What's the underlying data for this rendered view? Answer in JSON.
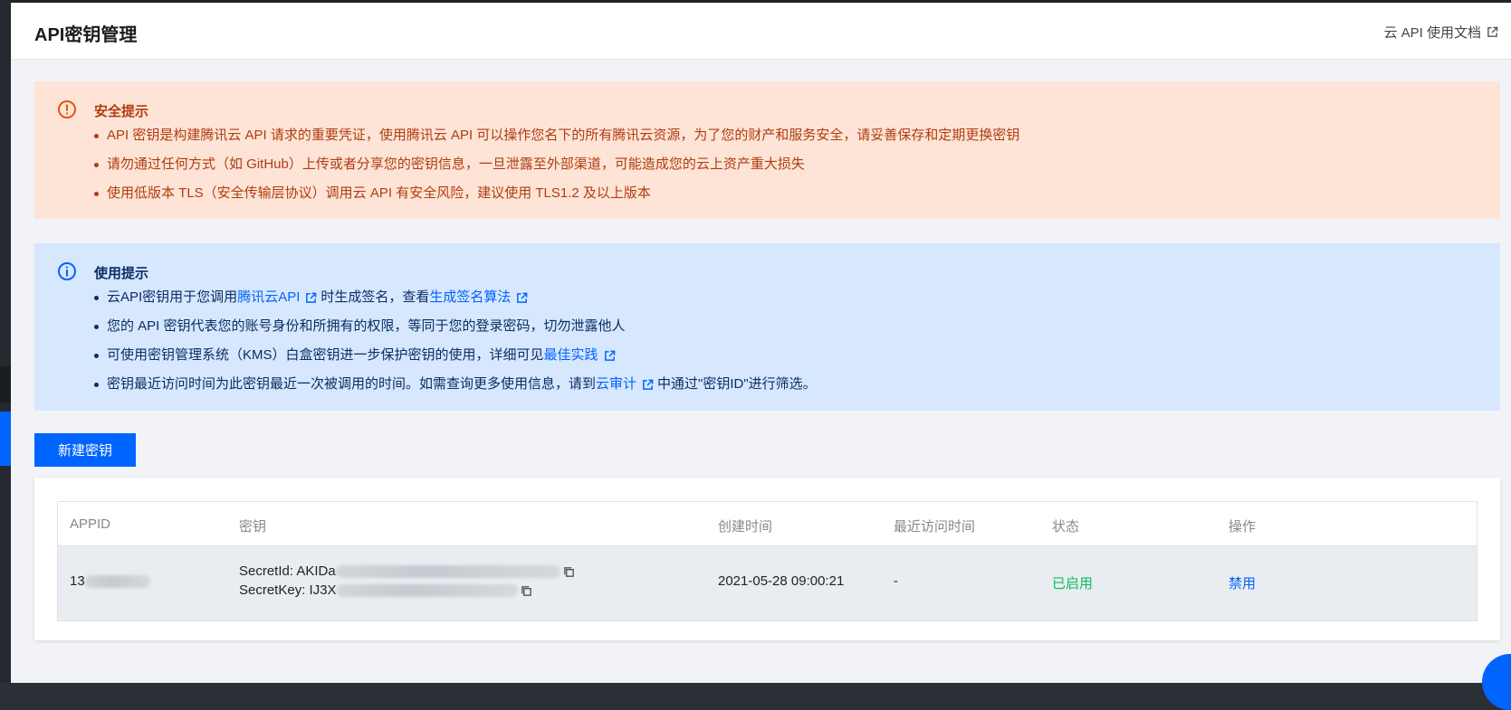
{
  "header": {
    "title": "API密钥管理",
    "doc_link": "云 API 使用文档"
  },
  "security_tip": {
    "title": "安全提示",
    "items": [
      "API 密钥是构建腾讯云 API 请求的重要凭证，使用腾讯云 API 可以操作您名下的所有腾讯云资源，为了您的财产和服务安全，请妥善保存和定期更换密钥",
      "请勿通过任何方式（如 GitHub）上传或者分享您的密钥信息，一旦泄露至外部渠道，可能造成您的云上资产重大损失",
      "使用低版本 TLS（安全传输层协议）调用云 API 有安全风险，建议使用 TLS1.2 及以上版本"
    ]
  },
  "usage_tip": {
    "title": "使用提示",
    "item1": {
      "a": "云API密钥用于您调用",
      "link1": "腾讯云API",
      "b": "时生成签名，查看",
      "link2": "生成签名算法"
    },
    "item2": "您的 API 密钥代表您的账号身份和所拥有的权限，等同于您的登录密码，切勿泄露他人",
    "item3": {
      "a": "可使用密钥管理系统（KMS）白盒密钥进一步保护密钥的使用，详细可见",
      "link": "最佳实践"
    },
    "item4": {
      "a": "密钥最近访问时间为此密钥最近一次被调用的时间。如需查询更多使用信息，请到",
      "link": "云审计",
      "b": "中通过\"密钥ID\"进行筛选。"
    }
  },
  "actions": {
    "new_key": "新建密钥"
  },
  "table": {
    "headers": [
      "APPID",
      "密钥",
      "创建时间",
      "最近访问时间",
      "状态",
      "操作"
    ],
    "rows": [
      {
        "appid": "13",
        "secret_id": "SecretId: AKIDa",
        "secret_key": "SecretKey: IJ3X",
        "created": "2021-05-28 09:00:21",
        "last_access": "-",
        "status": "已启用",
        "operation": "禁用"
      }
    ]
  },
  "colors": {
    "primary": "#0064ff",
    "warn_bg": "#fde4d6",
    "warn_text": "#b13c10",
    "info_bg": "#d7e7fd",
    "info_text": "#0a2e66",
    "success": "#0abf5b"
  }
}
